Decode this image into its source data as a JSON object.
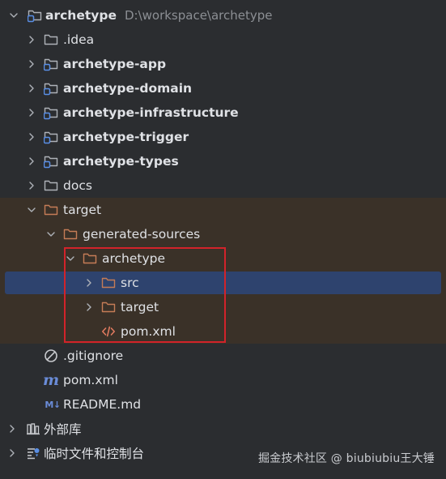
{
  "colors": {
    "background": "#2b2d30",
    "excluded_bg": "#3a3128",
    "selected_bg": "#2e436e",
    "folder_plain": "#aeb2b8",
    "folder_excluded": "#c57c56",
    "module_badge": "#5a8fe6",
    "highlight_box": "#d2232a"
  },
  "tree": {
    "root": {
      "label": "archetype",
      "path": "D:\\workspace\\archetype",
      "icon": "module-folder-icon"
    },
    "items": [
      {
        "label": ".idea",
        "icon": "folder-icon"
      },
      {
        "label": "archetype-app",
        "icon": "module-folder-icon"
      },
      {
        "label": "archetype-domain",
        "icon": "module-folder-icon"
      },
      {
        "label": "archetype-infrastructure",
        "icon": "module-folder-icon"
      },
      {
        "label": "archetype-trigger",
        "icon": "module-folder-icon"
      },
      {
        "label": "archetype-types",
        "icon": "module-folder-icon"
      },
      {
        "label": "docs",
        "icon": "folder-icon"
      },
      {
        "label": "target",
        "icon": "excluded-folder-icon"
      },
      {
        "label": "generated-sources",
        "icon": "excluded-folder-icon"
      },
      {
        "label": "archetype",
        "icon": "excluded-folder-icon"
      },
      {
        "label": "src",
        "icon": "excluded-folder-icon"
      },
      {
        "label": "target",
        "icon": "excluded-folder-icon"
      },
      {
        "label": "pom.xml",
        "icon": "xml-icon"
      },
      {
        "label": ".gitignore",
        "icon": "gitignore-icon"
      },
      {
        "label": "pom.xml",
        "icon": "maven-icon"
      },
      {
        "label": "README.md",
        "icon": "markdown-icon"
      },
      {
        "label": "外部库",
        "icon": "libraries-icon"
      },
      {
        "label": "临时文件和控制台",
        "icon": "scratches-icon"
      }
    ]
  },
  "watermark": "掘金技术社区 @ biubiubiu王大锤"
}
